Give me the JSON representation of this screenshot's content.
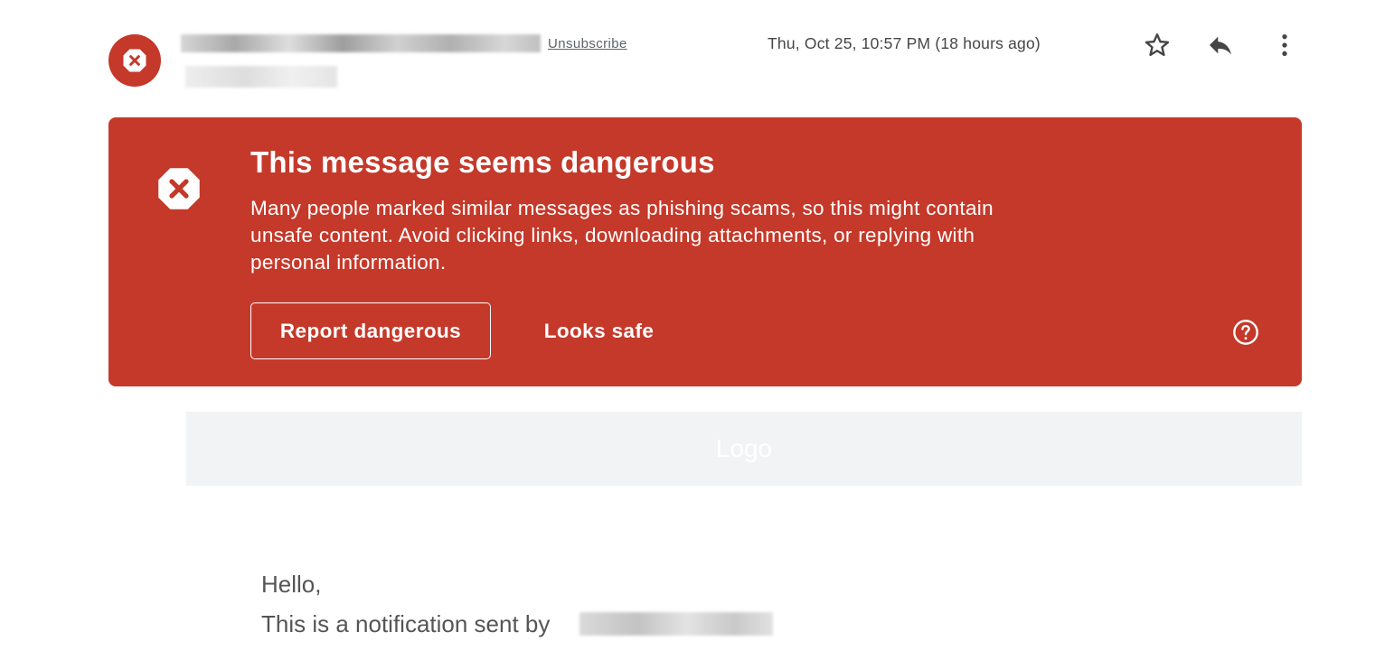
{
  "header": {
    "unsubscribe_label": "Unsubscribe",
    "date": "Thu, Oct 25, 10:57 PM (18 hours ago)",
    "icons": {
      "avatar": "danger-octagon-icon",
      "star": "star-outline-icon",
      "reply": "reply-icon",
      "more": "more-vert-icon"
    }
  },
  "warning": {
    "title": "This message seems dangerous",
    "description": "Many people marked similar messages as phishing scams, so this might contain unsafe content. Avoid clicking links, downloading attachments, or replying with personal information.",
    "report_label": "Report dangerous",
    "safe_label": "Looks safe",
    "icons": {
      "main": "danger-octagon-icon",
      "help": "help-circle-icon"
    }
  },
  "body": {
    "logo_text": "Logo",
    "greeting": "Hello,",
    "notification_text": "This is a notification sent by"
  },
  "colors": {
    "danger": "#c5392a",
    "logo_bar": "#f1f3f4",
    "text_muted": "#5f6368"
  }
}
